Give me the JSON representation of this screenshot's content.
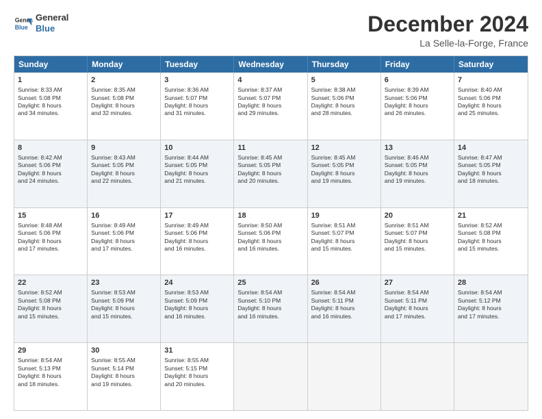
{
  "header": {
    "logo_line1": "General",
    "logo_line2": "Blue",
    "month": "December 2024",
    "location": "La Selle-la-Forge, France"
  },
  "days_of_week": [
    "Sunday",
    "Monday",
    "Tuesday",
    "Wednesday",
    "Thursday",
    "Friday",
    "Saturday"
  ],
  "rows": [
    {
      "alt": false,
      "cells": [
        {
          "day": "1",
          "lines": [
            "Sunrise: 8:33 AM",
            "Sunset: 5:08 PM",
            "Daylight: 8 hours",
            "and 34 minutes."
          ]
        },
        {
          "day": "2",
          "lines": [
            "Sunrise: 8:35 AM",
            "Sunset: 5:08 PM",
            "Daylight: 8 hours",
            "and 32 minutes."
          ]
        },
        {
          "day": "3",
          "lines": [
            "Sunrise: 8:36 AM",
            "Sunset: 5:07 PM",
            "Daylight: 8 hours",
            "and 31 minutes."
          ]
        },
        {
          "day": "4",
          "lines": [
            "Sunrise: 8:37 AM",
            "Sunset: 5:07 PM",
            "Daylight: 8 hours",
            "and 29 minutes."
          ]
        },
        {
          "day": "5",
          "lines": [
            "Sunrise: 8:38 AM",
            "Sunset: 5:06 PM",
            "Daylight: 8 hours",
            "and 28 minutes."
          ]
        },
        {
          "day": "6",
          "lines": [
            "Sunrise: 8:39 AM",
            "Sunset: 5:06 PM",
            "Daylight: 8 hours",
            "and 26 minutes."
          ]
        },
        {
          "day": "7",
          "lines": [
            "Sunrise: 8:40 AM",
            "Sunset: 5:06 PM",
            "Daylight: 8 hours",
            "and 25 minutes."
          ]
        }
      ]
    },
    {
      "alt": true,
      "cells": [
        {
          "day": "8",
          "lines": [
            "Sunrise: 8:42 AM",
            "Sunset: 5:06 PM",
            "Daylight: 8 hours",
            "and 24 minutes."
          ]
        },
        {
          "day": "9",
          "lines": [
            "Sunrise: 8:43 AM",
            "Sunset: 5:05 PM",
            "Daylight: 8 hours",
            "and 22 minutes."
          ]
        },
        {
          "day": "10",
          "lines": [
            "Sunrise: 8:44 AM",
            "Sunset: 5:05 PM",
            "Daylight: 8 hours",
            "and 21 minutes."
          ]
        },
        {
          "day": "11",
          "lines": [
            "Sunrise: 8:45 AM",
            "Sunset: 5:05 PM",
            "Daylight: 8 hours",
            "and 20 minutes."
          ]
        },
        {
          "day": "12",
          "lines": [
            "Sunrise: 8:45 AM",
            "Sunset: 5:05 PM",
            "Daylight: 8 hours",
            "and 19 minutes."
          ]
        },
        {
          "day": "13",
          "lines": [
            "Sunrise: 8:46 AM",
            "Sunset: 5:05 PM",
            "Daylight: 8 hours",
            "and 19 minutes."
          ]
        },
        {
          "day": "14",
          "lines": [
            "Sunrise: 8:47 AM",
            "Sunset: 5:05 PM",
            "Daylight: 8 hours",
            "and 18 minutes."
          ]
        }
      ]
    },
    {
      "alt": false,
      "cells": [
        {
          "day": "15",
          "lines": [
            "Sunrise: 8:48 AM",
            "Sunset: 5:06 PM",
            "Daylight: 8 hours",
            "and 17 minutes."
          ]
        },
        {
          "day": "16",
          "lines": [
            "Sunrise: 8:49 AM",
            "Sunset: 5:06 PM",
            "Daylight: 8 hours",
            "and 17 minutes."
          ]
        },
        {
          "day": "17",
          "lines": [
            "Sunrise: 8:49 AM",
            "Sunset: 5:06 PM",
            "Daylight: 8 hours",
            "and 16 minutes."
          ]
        },
        {
          "day": "18",
          "lines": [
            "Sunrise: 8:50 AM",
            "Sunset: 5:06 PM",
            "Daylight: 8 hours",
            "and 16 minutes."
          ]
        },
        {
          "day": "19",
          "lines": [
            "Sunrise: 8:51 AM",
            "Sunset: 5:07 PM",
            "Daylight: 8 hours",
            "and 15 minutes."
          ]
        },
        {
          "day": "20",
          "lines": [
            "Sunrise: 8:51 AM",
            "Sunset: 5:07 PM",
            "Daylight: 8 hours",
            "and 15 minutes."
          ]
        },
        {
          "day": "21",
          "lines": [
            "Sunrise: 8:52 AM",
            "Sunset: 5:08 PM",
            "Daylight: 8 hours",
            "and 15 minutes."
          ]
        }
      ]
    },
    {
      "alt": true,
      "cells": [
        {
          "day": "22",
          "lines": [
            "Sunrise: 8:52 AM",
            "Sunset: 5:08 PM",
            "Daylight: 8 hours",
            "and 15 minutes."
          ]
        },
        {
          "day": "23",
          "lines": [
            "Sunrise: 8:53 AM",
            "Sunset: 5:09 PM",
            "Daylight: 8 hours",
            "and 15 minutes."
          ]
        },
        {
          "day": "24",
          "lines": [
            "Sunrise: 8:53 AM",
            "Sunset: 5:09 PM",
            "Daylight: 8 hours",
            "and 16 minutes."
          ]
        },
        {
          "day": "25",
          "lines": [
            "Sunrise: 8:54 AM",
            "Sunset: 5:10 PM",
            "Daylight: 8 hours",
            "and 16 minutes."
          ]
        },
        {
          "day": "26",
          "lines": [
            "Sunrise: 8:54 AM",
            "Sunset: 5:11 PM",
            "Daylight: 8 hours",
            "and 16 minutes."
          ]
        },
        {
          "day": "27",
          "lines": [
            "Sunrise: 8:54 AM",
            "Sunset: 5:11 PM",
            "Daylight: 8 hours",
            "and 17 minutes."
          ]
        },
        {
          "day": "28",
          "lines": [
            "Sunrise: 8:54 AM",
            "Sunset: 5:12 PM",
            "Daylight: 8 hours",
            "and 17 minutes."
          ]
        }
      ]
    },
    {
      "alt": false,
      "cells": [
        {
          "day": "29",
          "lines": [
            "Sunrise: 8:54 AM",
            "Sunset: 5:13 PM",
            "Daylight: 8 hours",
            "and 18 minutes."
          ]
        },
        {
          "day": "30",
          "lines": [
            "Sunrise: 8:55 AM",
            "Sunset: 5:14 PM",
            "Daylight: 8 hours",
            "and 19 minutes."
          ]
        },
        {
          "day": "31",
          "lines": [
            "Sunrise: 8:55 AM",
            "Sunset: 5:15 PM",
            "Daylight: 8 hours",
            "and 20 minutes."
          ]
        },
        {
          "day": "",
          "lines": []
        },
        {
          "day": "",
          "lines": []
        },
        {
          "day": "",
          "lines": []
        },
        {
          "day": "",
          "lines": []
        }
      ]
    }
  ]
}
